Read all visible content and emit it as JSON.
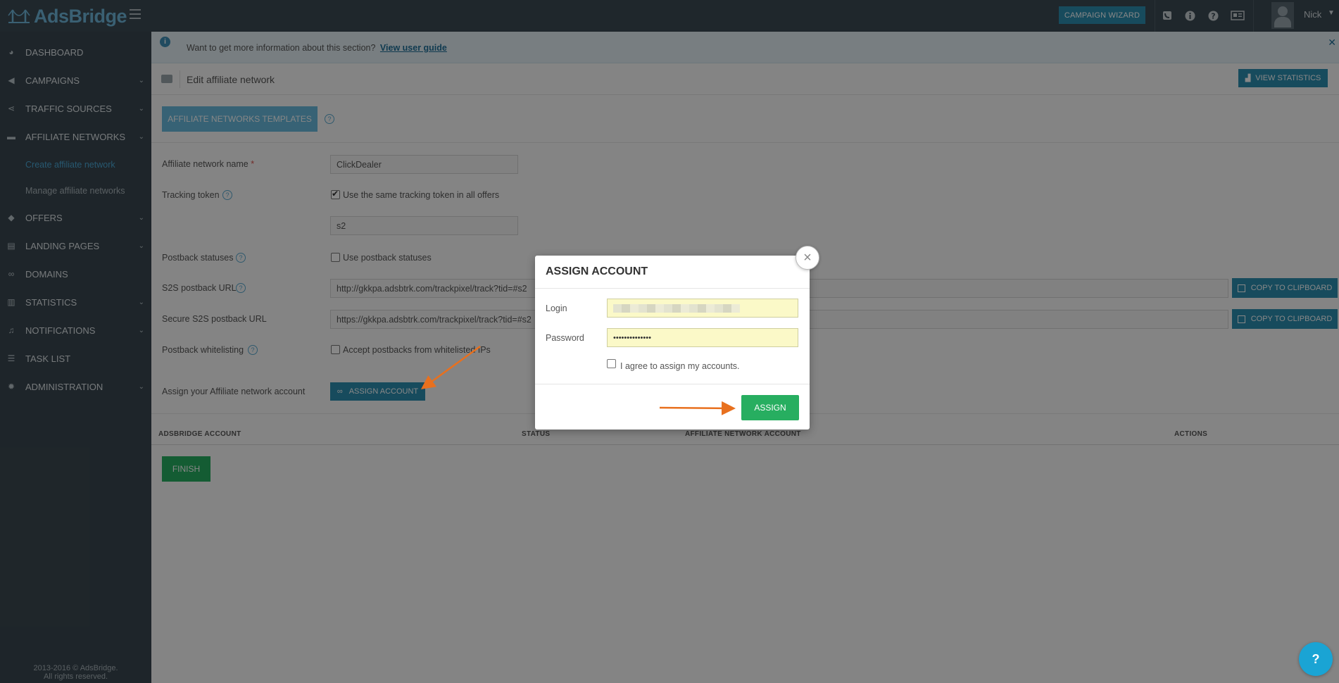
{
  "header": {
    "logo_text": "AdsBridge",
    "wizard_label": "CAMPAIGN WIZARD",
    "user_name": "Nick",
    "icons": [
      "phone-icon",
      "info-icon",
      "help-icon",
      "news-icon"
    ]
  },
  "sidebar": {
    "items": [
      {
        "label": "DASHBOARD",
        "icon": "dashboard-icon"
      },
      {
        "label": "CAMPAIGNS",
        "icon": "megaphone-icon"
      },
      {
        "label": "TRAFFIC SOURCES",
        "icon": "share-icon"
      },
      {
        "label": "AFFILIATE NETWORKS",
        "icon": "briefcase-icon"
      },
      {
        "label": "OFFERS",
        "icon": "tags-icon"
      },
      {
        "label": "LANDING PAGES",
        "icon": "list-icon"
      },
      {
        "label": "DOMAINS",
        "icon": "link-icon"
      },
      {
        "label": "STATISTICS",
        "icon": "bar-chart-icon"
      },
      {
        "label": "NOTIFICATIONS",
        "icon": "bell-icon"
      },
      {
        "label": "TASK LIST",
        "icon": "tasks-icon"
      },
      {
        "label": "ADMINISTRATION",
        "icon": "gear-icon"
      }
    ],
    "sub_items": [
      "Create affiliate network",
      "Manage affiliate networks"
    ],
    "copyright_1": "2013-2016 © AdsBridge.",
    "copyright_2": "All rights reserved."
  },
  "info_bar": {
    "text": "Want to get more information about this section?",
    "link": "View user guide"
  },
  "page": {
    "title": "Edit affiliate network",
    "view_stats_label": "VIEW STATISTICS",
    "templates_label": "AFFILIATE NETWORKS TEMPLATES"
  },
  "form": {
    "name_label": "Affiliate network name",
    "name_value": "ClickDealer",
    "token_label": "Tracking token",
    "token_checkbox_label": "Use the same tracking token in all offers",
    "token_value": "s2",
    "postback_status_label": "Postback statuses",
    "postback_status_checkbox": "Use postback statuses",
    "s2s_label": "S2S postback URL",
    "s2s_value": "http://gkkpa.adsbtrk.com/trackpixel/track?tid=#s2",
    "secure_s2s_label": "Secure S2S postback URL",
    "secure_s2s_value": "https://gkkpa.adsbtrk.com/trackpixel/track?tid=#s2",
    "copy_label": "COPY TO CLIPBOARD",
    "whitelist_label": "Postback whitelisting",
    "whitelist_checkbox": "Accept postbacks from whitelisted IPs",
    "assign_label": "Assign your Affiliate network account",
    "assign_button": "ASSIGN ACCOUNT"
  },
  "table": {
    "columns": [
      "ADSBRIDGE ACCOUNT",
      "STATUS",
      "AFFILIATE NETWORK ACCOUNT",
      "ACTIONS"
    ]
  },
  "finish_label": "FINISH",
  "modal": {
    "title": "ASSIGN ACCOUNT",
    "login_label": "Login",
    "password_label": "Password",
    "password_value": "••••••••••••••",
    "agree_label": "I agree to assign my accounts.",
    "assign_button": "ASSIGN"
  },
  "colors": {
    "accent": "#2d8fb0",
    "success": "#27ae60",
    "sidebar": "#3a4750",
    "arrow": "#e8701e"
  }
}
